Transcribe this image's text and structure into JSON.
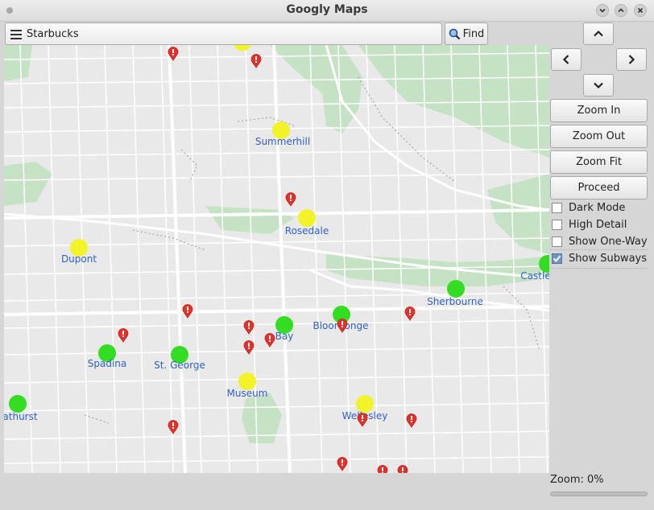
{
  "window": {
    "title": "Googly Maps"
  },
  "search": {
    "value": "Starbucks",
    "find_label": "Find"
  },
  "controls": {
    "zoom_in": "Zoom In",
    "zoom_out": "Zoom Out",
    "zoom_fit": "Zoom Fit",
    "proceed": "Proceed"
  },
  "options": [
    {
      "label": "Dark Mode",
      "checked": false
    },
    {
      "label": "High Detail",
      "checked": false
    },
    {
      "label": "Show One-Way",
      "checked": false
    },
    {
      "label": "Show Subways",
      "checked": true
    }
  ],
  "zoom": {
    "label": "Zoom: 0%",
    "value": 0
  },
  "colors": {
    "subway_green": "#33dd22",
    "subway_yellow": "#f3f32a",
    "pin_red": "#e8302a",
    "label_blue": "#2f5fd0",
    "park_green": "#bfe0c0"
  },
  "stations": [
    {
      "name": "Summerhill",
      "color": "yellow",
      "labelled": true
    },
    {
      "name": "Rosedale",
      "color": "yellow",
      "labelled": true
    },
    {
      "name": "Dupont",
      "color": "yellow",
      "labelled": true
    },
    {
      "name": "Sherbourne",
      "color": "green",
      "labelled": true
    },
    {
      "name": "Castle",
      "color": "green",
      "labelled": true
    },
    {
      "name": "Bay",
      "color": "green",
      "labelled": true
    },
    {
      "name": "Bloor-Yonge",
      "color": "green",
      "labelled": true
    },
    {
      "name": "Spadina",
      "color": "green",
      "labelled": true
    },
    {
      "name": "St. George",
      "color": "green",
      "labelled": true
    },
    {
      "name": "Museum",
      "color": "yellow",
      "labelled": true
    },
    {
      "name": "Wellesley",
      "color": "yellow",
      "labelled": true
    },
    {
      "name": "athurst",
      "color": "green",
      "labelled": true
    },
    {
      "name": "",
      "color": "yellow",
      "labelled": false
    }
  ],
  "pin_count": 16
}
